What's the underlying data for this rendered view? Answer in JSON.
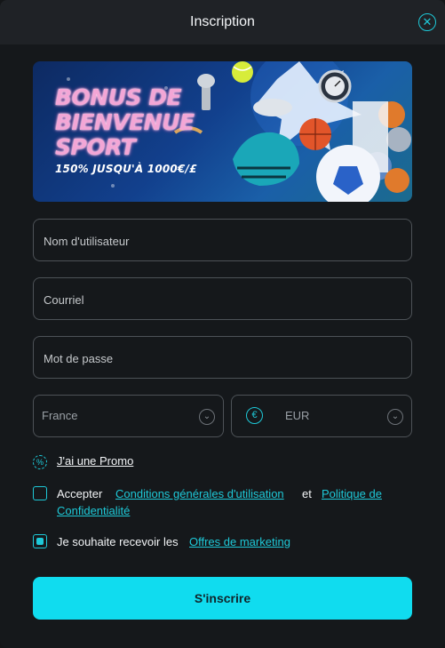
{
  "header": {
    "title": "Inscription",
    "close_icon": "close-x-icon"
  },
  "banner": {
    "title_lines": [
      "BONUS DE",
      "BIENVENUE",
      "SPORT"
    ],
    "subtitle": "150% JUSQU'À 1000€/£"
  },
  "form": {
    "username_placeholder": "Nom d'utilisateur",
    "email_placeholder": "Courriel",
    "password_placeholder": "Mot de passe",
    "country_value": "France",
    "currency_value": "EUR",
    "currency_symbol": "€"
  },
  "promo": {
    "label": "J'ai une Promo"
  },
  "terms": {
    "prefix": "Accepter",
    "terms_link": "Conditions générales d'utilisation",
    "and": "et",
    "privacy_link_line1": "Politique de",
    "privacy_link_line2": "Confidentialité",
    "checked": false
  },
  "marketing": {
    "prefix": "Je souhaite recevoir les",
    "link": "Offres de marketing",
    "checked": true
  },
  "submit": {
    "label": "S'inscrire"
  },
  "colors": {
    "accent": "#10dcef",
    "background": "#15181b",
    "header": "#1f2226"
  }
}
